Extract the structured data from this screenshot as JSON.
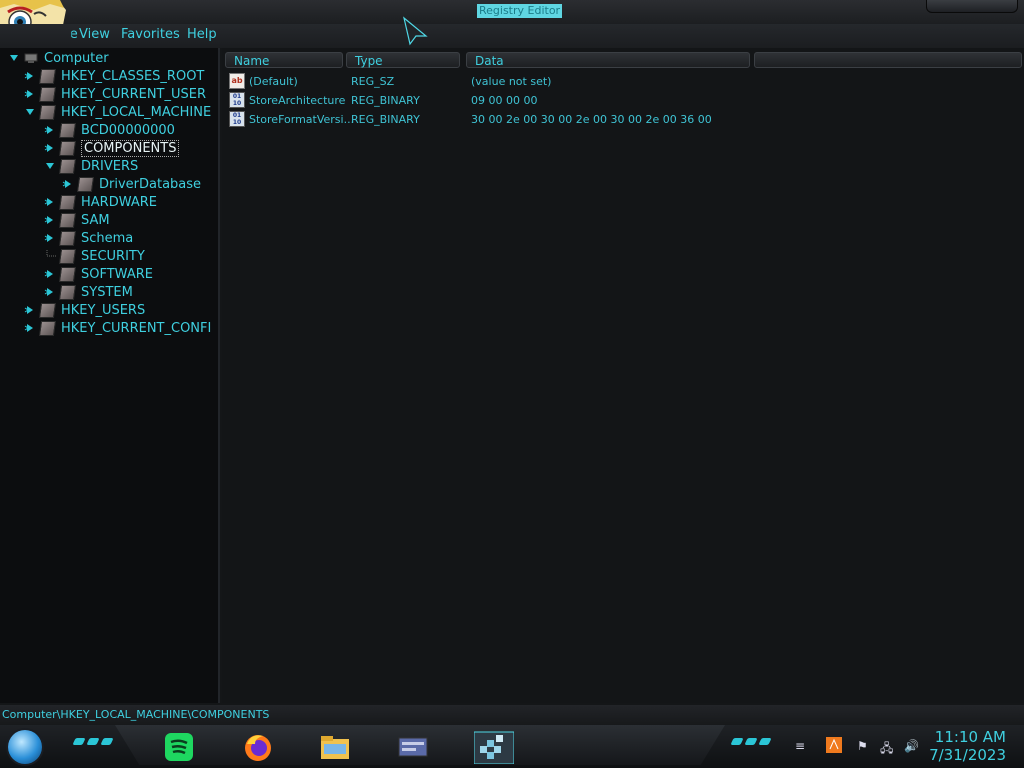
{
  "window": {
    "title": "Registry Editor"
  },
  "menu": [
    "File",
    "View",
    "Favorites",
    "Help"
  ],
  "tree": {
    "root": "Computer",
    "items": [
      {
        "label": "HKEY_CLASSES_ROOT",
        "level": 1,
        "state": "collapsed"
      },
      {
        "label": "HKEY_CURRENT_USER",
        "level": 1,
        "state": "collapsed"
      },
      {
        "label": "HKEY_LOCAL_MACHINE",
        "level": 1,
        "state": "expanded"
      },
      {
        "label": "BCD00000000",
        "level": 2,
        "state": "collapsed"
      },
      {
        "label": "COMPONENTS",
        "level": 2,
        "state": "collapsed",
        "selected": true
      },
      {
        "label": "DRIVERS",
        "level": 2,
        "state": "expanded"
      },
      {
        "label": "DriverDatabase",
        "level": 3,
        "state": "collapsed"
      },
      {
        "label": "HARDWARE",
        "level": 2,
        "state": "collapsed"
      },
      {
        "label": "SAM",
        "level": 2,
        "state": "collapsed"
      },
      {
        "label": "Schema",
        "level": 2,
        "state": "collapsed"
      },
      {
        "label": "SECURITY",
        "level": 2,
        "state": "leaf"
      },
      {
        "label": "SOFTWARE",
        "level": 2,
        "state": "collapsed"
      },
      {
        "label": "SYSTEM",
        "level": 2,
        "state": "collapsed"
      },
      {
        "label": "HKEY_USERS",
        "level": 1,
        "state": "collapsed"
      },
      {
        "label": "HKEY_CURRENT_CONFI",
        "level": 1,
        "state": "collapsed"
      }
    ]
  },
  "list": {
    "columns": [
      "Name",
      "Type",
      "Data"
    ],
    "rows": [
      {
        "icon": "string-value-icon",
        "name": "(Default)",
        "type": "REG_SZ",
        "data": "(value not set)"
      },
      {
        "icon": "binary-value-icon",
        "name": "StoreArchitecture",
        "type": "REG_BINARY",
        "data": "09 00 00 00"
      },
      {
        "icon": "binary-value-icon",
        "name": "StoreFormatVersi...",
        "type": "REG_BINARY",
        "data": "30 00 2e 00 30 00 2e 00 30 00 2e 00 36 00"
      }
    ]
  },
  "status": {
    "path": "Computer\\HKEY_LOCAL_MACHINE\\COMPONENTS"
  },
  "taskbar": {
    "apps": [
      "spotify-icon",
      "firefox-icon",
      "file-explorer-icon",
      "window-switcher-icon",
      "registry-editor-icon"
    ],
    "clock": {
      "time": "11:10 AM",
      "date": "7/31/2023"
    }
  },
  "colors": {
    "accent": "#3fd0e0",
    "background": "#141618",
    "tree_bg": "#0c0d0f"
  }
}
